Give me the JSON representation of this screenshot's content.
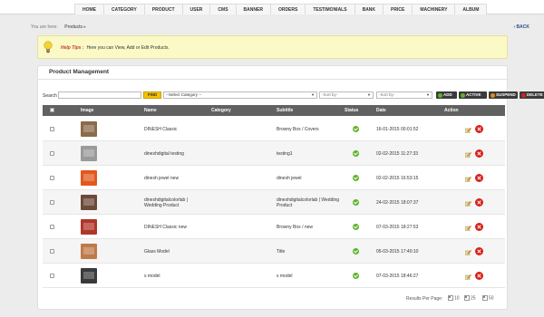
{
  "nav": [
    "HOME",
    "CATEGORY",
    "PRODUCT",
    "USER",
    "CMS",
    "BANNER",
    "ORDERS",
    "TESTIMONIALS",
    "BANK",
    "PRICE",
    "MACHINERY",
    "ALBUM"
  ],
  "breadcrumb": {
    "prefix": "You are here:",
    "current": "Products"
  },
  "back_label": "BACK",
  "tip": {
    "label": "Help Tips :",
    "text": "Here you can View, Add or Edit Products."
  },
  "panel_title": "Product Management",
  "filters": {
    "search_label": "Search",
    "find_label": "FIND",
    "category": "--Select Category --",
    "sort1": "-Sort by-",
    "sort2": "-Sort by-",
    "add": "ADD",
    "active": "ACTIVE",
    "suspend": "SUSPEND",
    "delete": "DELETE"
  },
  "columns": {
    "image": "Image",
    "name": "Name",
    "category": "Category",
    "subtitle": "Subtitle",
    "status": "Status",
    "date": "Date",
    "action": "Action"
  },
  "rows": [
    {
      "name": "DINESH Classic",
      "category": "",
      "subtitle": "Browny Box / Covers",
      "date": "16-01-2015 00:01:52",
      "thumb": "#8a6b4a"
    },
    {
      "name": "dineshdigital testing",
      "category": "",
      "subtitle": "testing1",
      "date": "02-02-2015 11:27:33",
      "thumb": "#9a9a9a"
    },
    {
      "name": "dinesh jewel new",
      "category": "",
      "subtitle": "dinesh jewel",
      "date": "02-02-2015 16:53:15",
      "thumb": "#e2581b"
    },
    {
      "name": "dineshdigitalcolorlab | Wedding Product",
      "category": "",
      "subtitle": "dineshdigitalcolorlab | Wedding Product",
      "date": "24-02-2015 18:07:37",
      "thumb": "#6b4a3a"
    },
    {
      "name": "DINESH Classic new",
      "category": "",
      "subtitle": "Browny Box / new",
      "date": "07-03-2015 18:27:53",
      "thumb": "#b0362a"
    },
    {
      "name": "Glass Model",
      "category": "",
      "subtitle": "Title",
      "date": "05-03-2015 17:40:10",
      "thumb": "#c07a4a"
    },
    {
      "name": "s model",
      "category": "",
      "subtitle": "s model",
      "date": "07-03-2015 18:46:27",
      "thumb": "#3a3a3a"
    }
  ],
  "paging": {
    "label": "Results Per Page:",
    "options": [
      "10",
      "25",
      "50"
    ]
  },
  "colors": {
    "accent_yellow": "#f3c200",
    "status_green": "#5fb32a",
    "delete_red": "#d9201a",
    "header_dark": "#616161"
  }
}
